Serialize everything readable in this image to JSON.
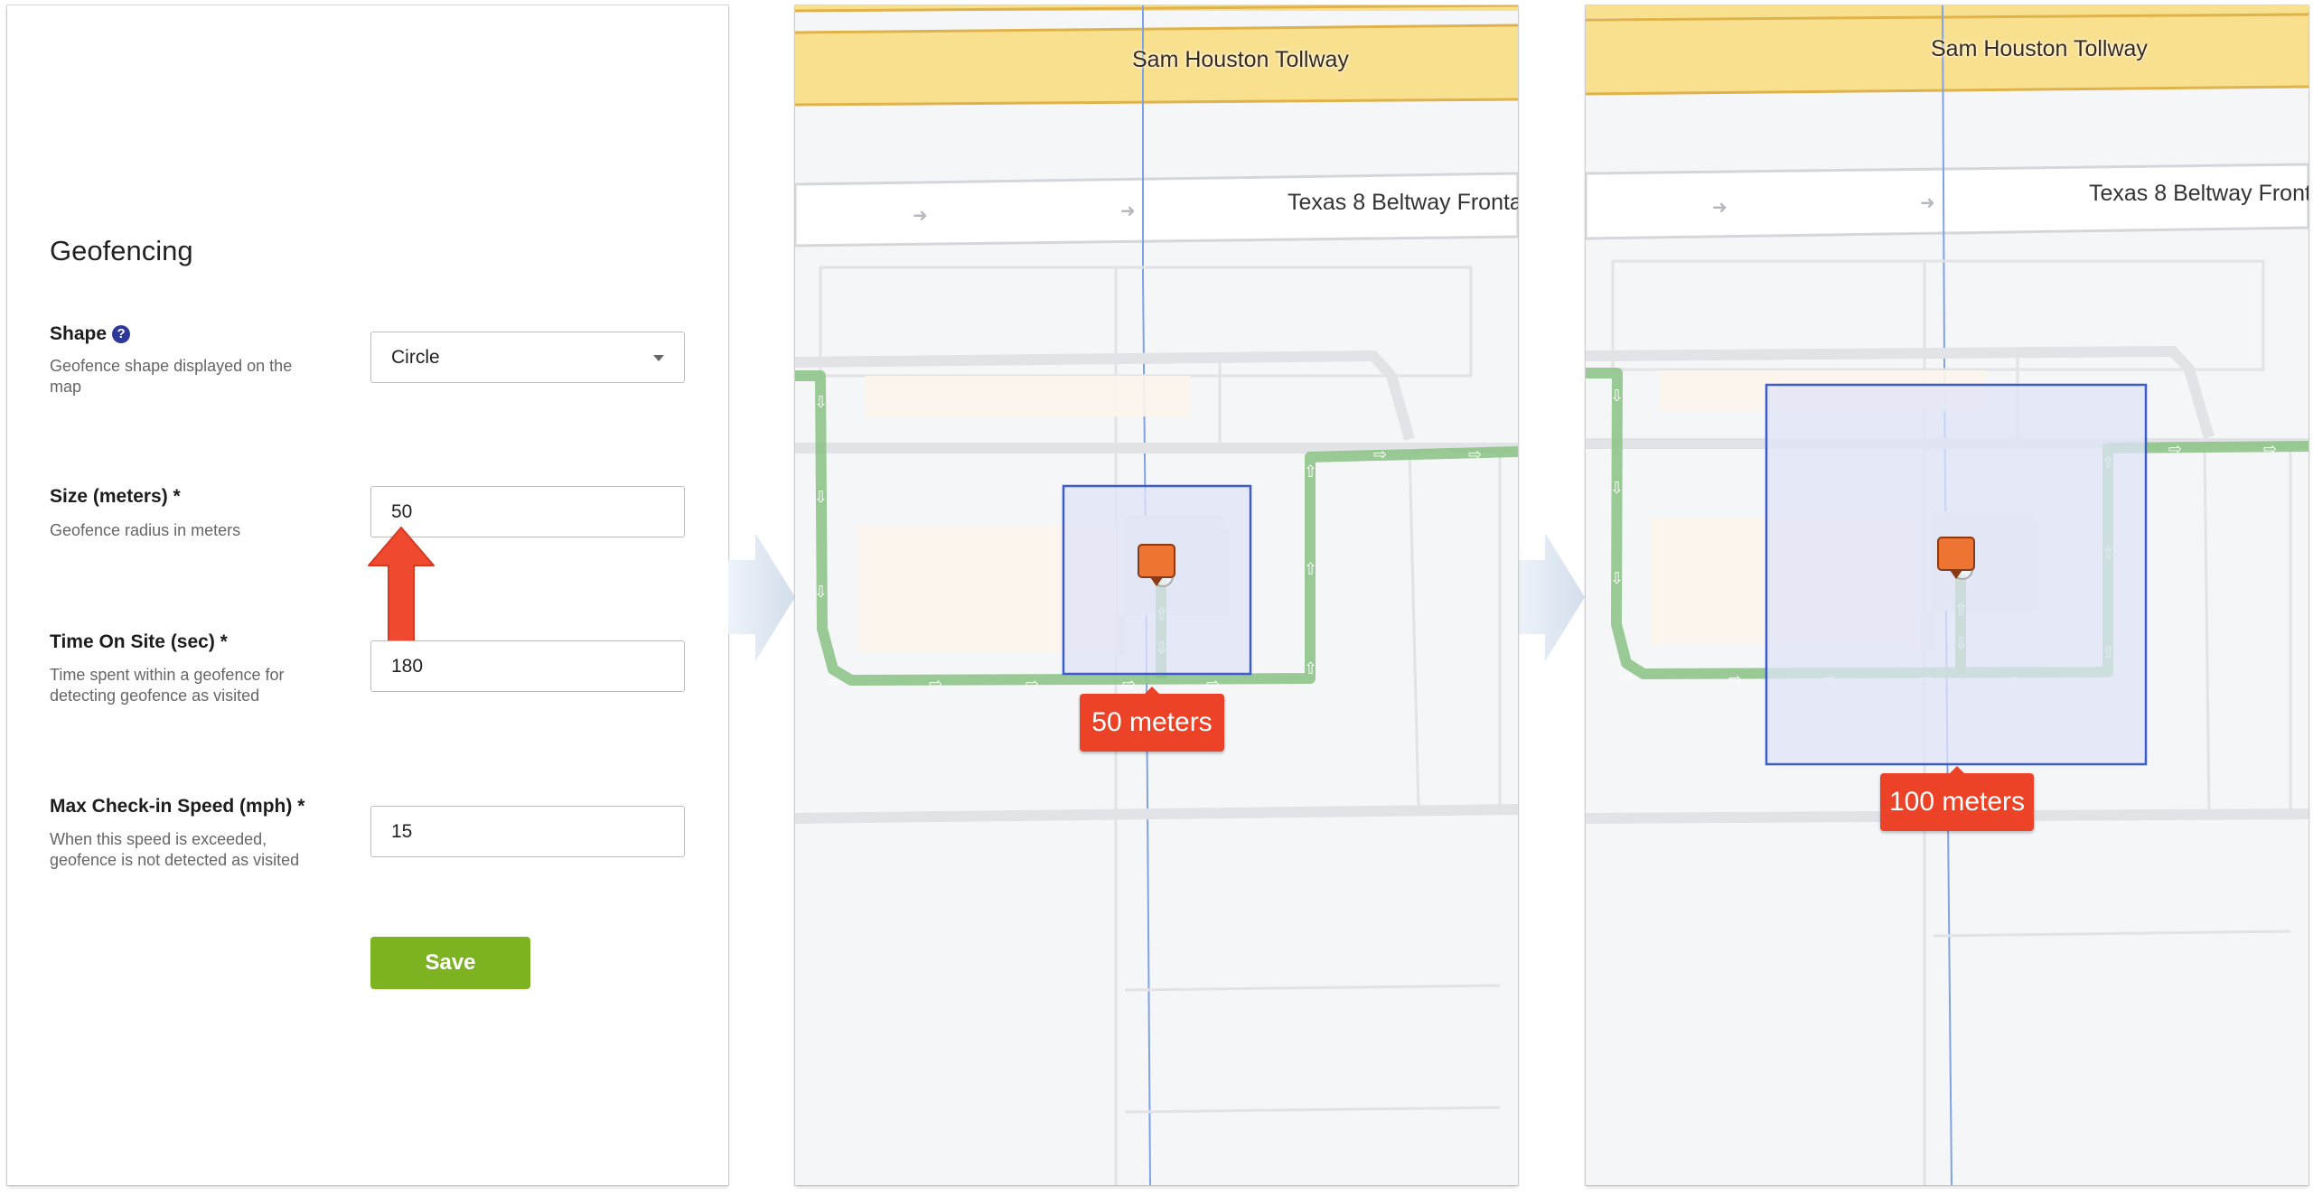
{
  "form": {
    "title": "Geofencing",
    "fields": [
      {
        "label": "Shape",
        "description": "Geofence shape displayed on the map",
        "value": "Circle",
        "type": "select",
        "help_icon": "question-circle-icon"
      },
      {
        "label": "Size (meters) *",
        "description": "Geofence radius in meters",
        "value": "50",
        "type": "text"
      },
      {
        "label": "Time On Site (sec) *",
        "description": "Time spent within a geofence for detecting geofence as visited",
        "value": "180",
        "type": "text"
      },
      {
        "label": "Max Check-in Speed (mph) *",
        "description": "When this speed is exceeded, geofence is not detected as visited",
        "value": "15",
        "type": "text"
      }
    ],
    "save_label": "Save",
    "help_glyph": "?",
    "colors": {
      "save": "#7db321",
      "help": "#2e3a9a",
      "annotation_arrow": "#ef4a2f"
    }
  },
  "maps": [
    {
      "road_top": "Sam Houston Tollway",
      "road_second": "Texas 8 Beltway Fronta",
      "geofence_label": "50 meters",
      "geofence_size_m": 50
    },
    {
      "road_top": "Sam Houston Tollway",
      "road_second": "Texas 8 Beltway Front",
      "geofence_label": "100 meters",
      "geofence_size_m": 100
    }
  ],
  "map_colors": {
    "tollway": "#f8e08e",
    "route": "#8fc488",
    "geofence_stroke": "#3d5ccc",
    "geofence_fill": "#dfe4f7",
    "badge": "#ec4328",
    "pin": "#ed7433"
  }
}
